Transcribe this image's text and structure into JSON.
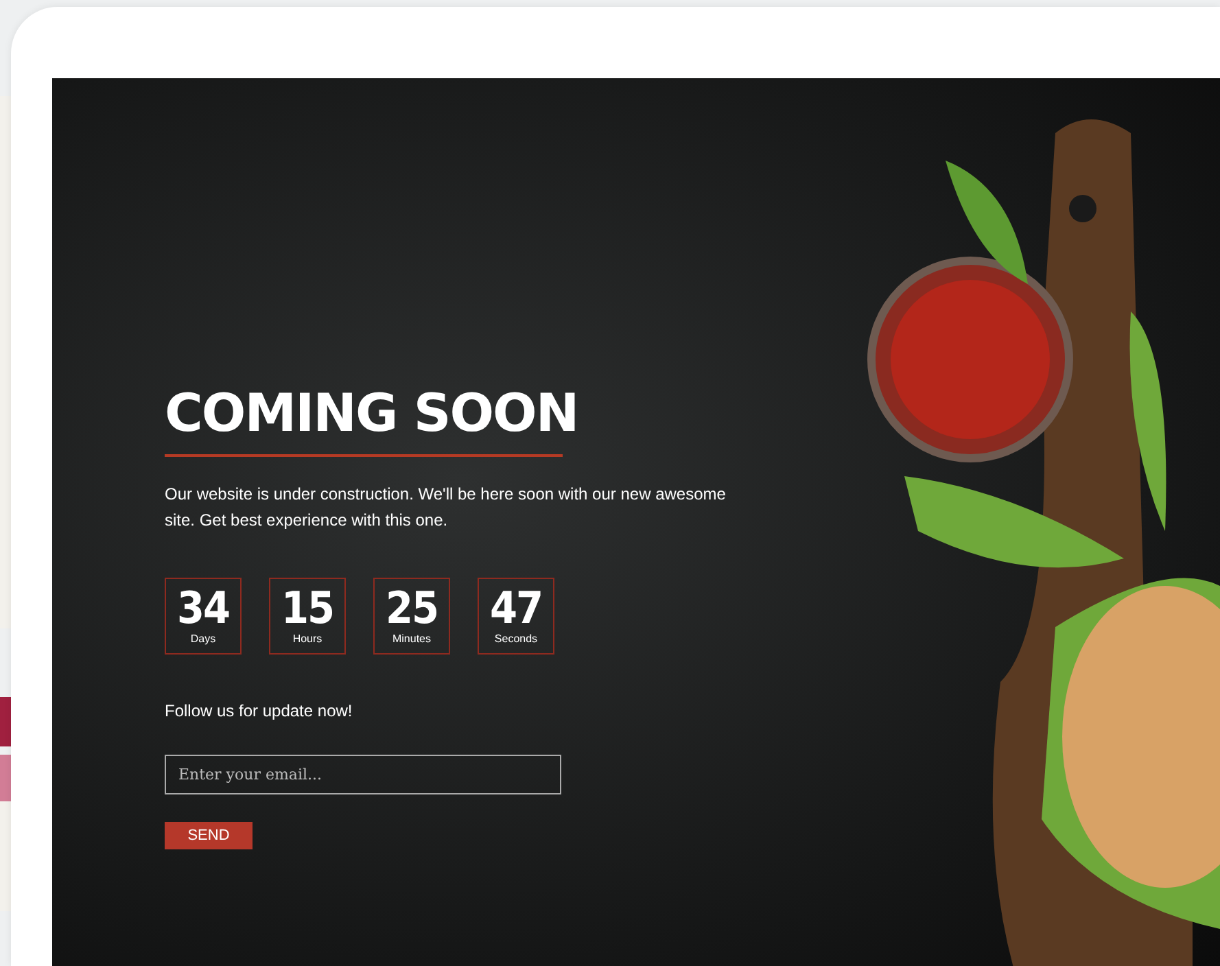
{
  "hero": {
    "title": "COMING SOON",
    "description": "Our website is under construction. We'll be here soon with our new awesome site. Get best experience with this one."
  },
  "countdown": [
    {
      "value": "34",
      "unit": "Days"
    },
    {
      "value": "15",
      "unit": "Hours"
    },
    {
      "value": "25",
      "unit": "Minutes"
    },
    {
      "value": "47",
      "unit": "Seconds"
    }
  ],
  "subscribe": {
    "heading": "Follow us for update now!",
    "email": {
      "placeholder": "Enter your email..."
    },
    "button": "SEND"
  }
}
